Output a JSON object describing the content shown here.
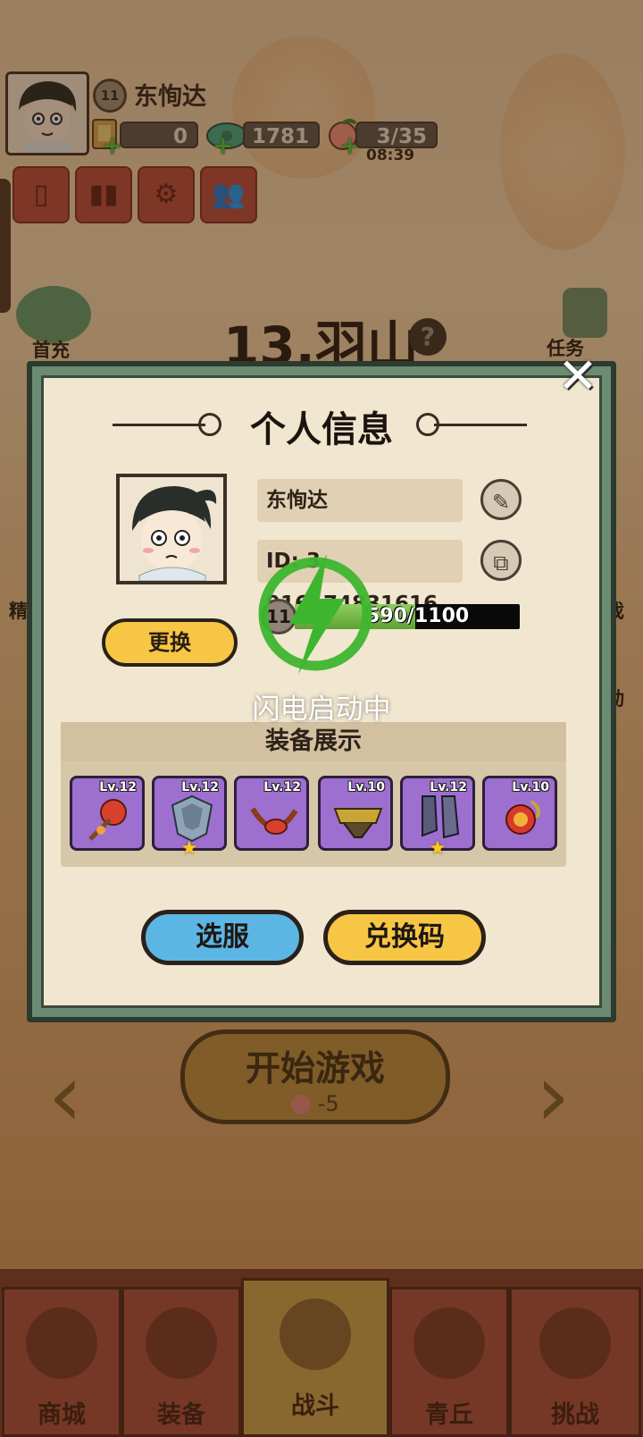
{
  "hud": {
    "player_level": "11",
    "player_name": "东恂达",
    "coins": "0",
    "gems": "1781",
    "stamina": "3/35",
    "stamina_timer": "08:39"
  },
  "stage": {
    "title": "13.羽山",
    "help": "?"
  },
  "side_buttons": {
    "first_recharge": "首充",
    "tasks": "任务",
    "left_partial": "精",
    "right_partial_1": "戏",
    "right_partial_2": "动"
  },
  "modal": {
    "title": "个人信息",
    "name": "东恂达",
    "id_text": "ID: 3  916174831616",
    "level": "11",
    "xp_text": "590/1100",
    "xp_fraction": 0.536,
    "swap_button": "更换",
    "equipment_header": "装备展示",
    "equipment": [
      {
        "level": "Lv.12",
        "starred": false,
        "icon": "red-flower-weapon-icon"
      },
      {
        "level": "Lv.12",
        "starred": true,
        "icon": "silver-armor-icon"
      },
      {
        "level": "Lv.12",
        "starred": false,
        "icon": "red-ribbon-necklace-icon"
      },
      {
        "level": "Lv.10",
        "starred": false,
        "icon": "gold-belt-icon"
      },
      {
        "level": "Lv.12",
        "starred": true,
        "icon": "dark-boots-icon"
      },
      {
        "level": "Lv.10",
        "starred": false,
        "icon": "red-orb-ring-icon"
      }
    ],
    "select_server_button": "选服",
    "redeem_code_button": "兑换码"
  },
  "loading": {
    "text": "闪电启动中"
  },
  "main": {
    "start_button": "开始游戏",
    "start_cost": "-5"
  },
  "bottom_nav": [
    {
      "label": "商城",
      "active": false
    },
    {
      "label": "装备",
      "active": false
    },
    {
      "label": "战斗",
      "active": true
    },
    {
      "label": "青丘",
      "active": false
    },
    {
      "label": "挑战",
      "active": false
    }
  ],
  "colors": {
    "modal_frame": "#6b8b72",
    "purple_slot": "#9d6fce",
    "yellow_button": "#f7c644",
    "blue_button": "#5bb6e4",
    "loader_green": "#3db52f"
  }
}
